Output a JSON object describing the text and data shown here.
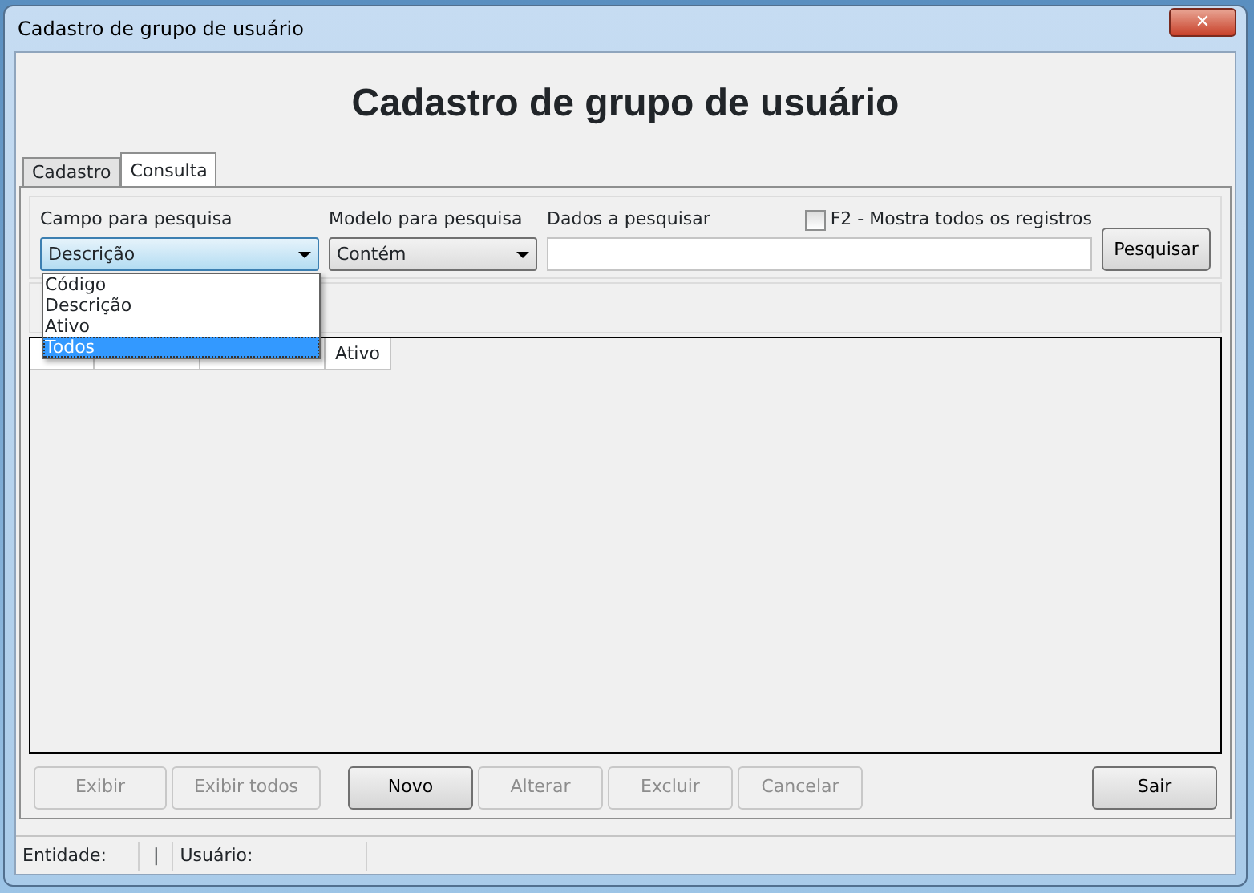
{
  "window": {
    "title": "Cadastro de grupo de usuário",
    "close": "✕"
  },
  "heading": "Cadastro de grupo de usuário",
  "tabs": [
    {
      "label": "Cadastro",
      "selected": false
    },
    {
      "label": "Consulta",
      "selected": true
    }
  ],
  "search": {
    "field_label": "Campo para pesquisa",
    "field_value": "Descrição",
    "model_label": "Modelo para pesquisa",
    "model_value": "Contém",
    "data_label": "Dados a pesquisar",
    "show_all": {
      "label": "F2 - Mostra todos os registros",
      "checked": false
    },
    "button": "Pesquisar"
  },
  "dropdown": [
    {
      "label": "Código",
      "selected": false
    },
    {
      "label": "Descrição",
      "selected": false
    },
    {
      "label": "Ativo",
      "selected": false
    },
    {
      "label": "Todos",
      "selected": true
    }
  ],
  "grid": {
    "columns": [
      "Ativo"
    ]
  },
  "buttons": [
    {
      "label": "Exibir",
      "disabled": true
    },
    {
      "label": "Exibir todos",
      "disabled": true
    },
    {
      "label": "Novo",
      "disabled": false
    },
    {
      "label": "Alterar",
      "disabled": true
    },
    {
      "label": "Excluir",
      "disabled": true
    },
    {
      "label": "Cancelar",
      "disabled": true
    },
    {
      "label": "Sair",
      "disabled": false
    }
  ],
  "status_bar": [
    "Entidade:",
    "|",
    "Usuário:"
  ]
}
